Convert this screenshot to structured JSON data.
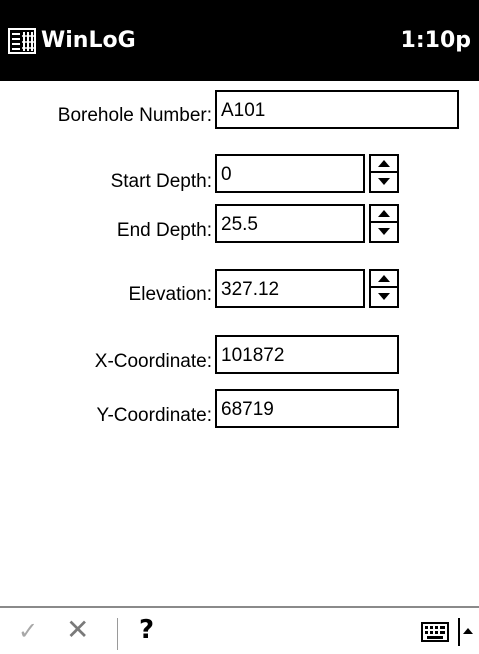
{
  "titlebar": {
    "app_title": "WinLoG",
    "clock": "1:10p",
    "app_icon": "winlog-app-icon"
  },
  "form": {
    "borehole_number": {
      "label": "Borehole Number:",
      "value": "A101"
    },
    "start_depth": {
      "label": "Start Depth:",
      "value": "0"
    },
    "end_depth": {
      "label": "End Depth:",
      "value": "25.5"
    },
    "elevation": {
      "label": "Elevation:",
      "value": "327.12"
    },
    "x_coordinate": {
      "label": "X-Coordinate:",
      "value": "101872"
    },
    "y_coordinate": {
      "label": "Y-Coordinate:",
      "value": "68719"
    }
  },
  "bottombar": {
    "ok_glyph": "✓",
    "cancel_glyph": "✕",
    "help_glyph": "?",
    "ok_icon": "checkmark-icon",
    "cancel_icon": "close-icon",
    "keyboard_icon": "keyboard-icon"
  },
  "colors": {
    "titlebar_bg": "#000000",
    "titlebar_text": "#ffffff",
    "disabled_ok": "#a8a8a8"
  }
}
